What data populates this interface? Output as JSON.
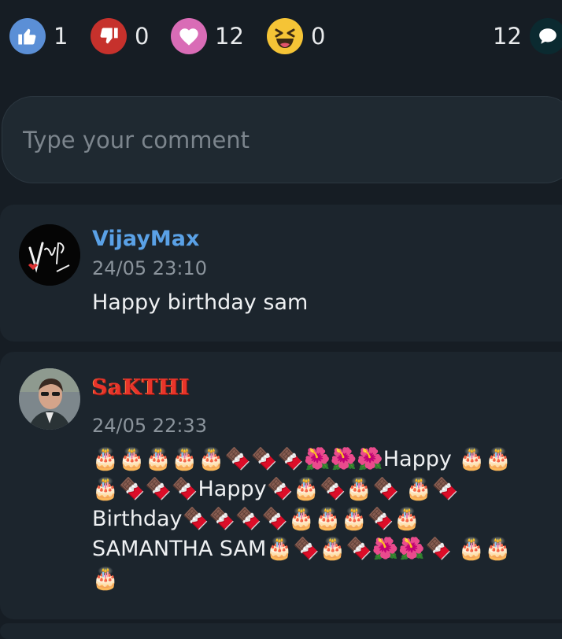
{
  "reactions": {
    "like": {
      "icon": "thumbs-up-icon",
      "count": "1",
      "color": "#5b8fd6"
    },
    "dislike": {
      "icon": "thumbs-down-icon",
      "count": "0",
      "color": "#c6312c"
    },
    "love": {
      "icon": "heart-icon",
      "count": "12",
      "color": "#d96cb6"
    },
    "laugh": {
      "icon": "laughing-face-icon",
      "count": "0",
      "color": "#f5c436"
    }
  },
  "comments_count": {
    "count": "12",
    "icon": "speech-bubble-icon"
  },
  "comment_input": {
    "placeholder": "Type your comment"
  },
  "comments": [
    {
      "username": "VijayMax",
      "timestamp": "24/05 23:10",
      "text": "Happy birthday sam"
    },
    {
      "username": "SaKTHI",
      "timestamp": "24/05 22:33",
      "text": "🎂🎂🎂🎂🎂🍫🍫🍫🌺🌺🌺Happy 🎂🎂🎂🍫🍫🍫Happy🍫🎂🍫🎂🍫 🎂🍫Birthday🍫🍫🍫🍫🎂🎂🎂🍫🎂 SAMANTHA SAM🎂🍫🎂🍫🌺🌺🍫 🎂🎂🎂"
    }
  ]
}
